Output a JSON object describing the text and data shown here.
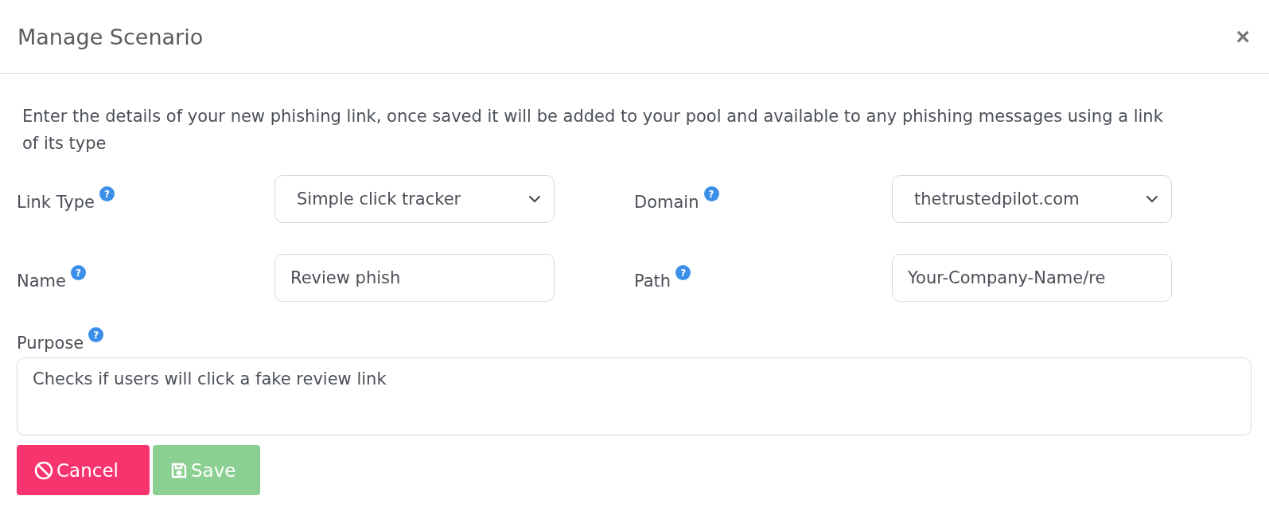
{
  "dialog": {
    "title": "Manage Scenario",
    "close": "×"
  },
  "description": "Enter the details of your new phishing link, once saved it will be added to your pool and available to any phishing messages using a link of its type",
  "fields": [
    {
      "label": "Link Type",
      "hint": "?",
      "kind": "select",
      "value": "Simple click tracker"
    },
    {
      "label": "Domain",
      "hint": "?",
      "kind": "select",
      "value": "thetrustedpilot.com"
    },
    {
      "label": "Name",
      "hint": "?",
      "kind": "input",
      "value": "Review phish"
    },
    {
      "label": "Path",
      "hint": "?",
      "kind": "input",
      "value": "Your-Company-Name/re"
    }
  ],
  "purpose": {
    "label": "Purpose",
    "hint": "?",
    "value": "Checks if users will click a fake review link"
  },
  "buttons": [
    {
      "label": "Cancel",
      "kind": "cancel",
      "disabled": false
    },
    {
      "label": "Save",
      "kind": "save",
      "disabled": true
    }
  ]
}
